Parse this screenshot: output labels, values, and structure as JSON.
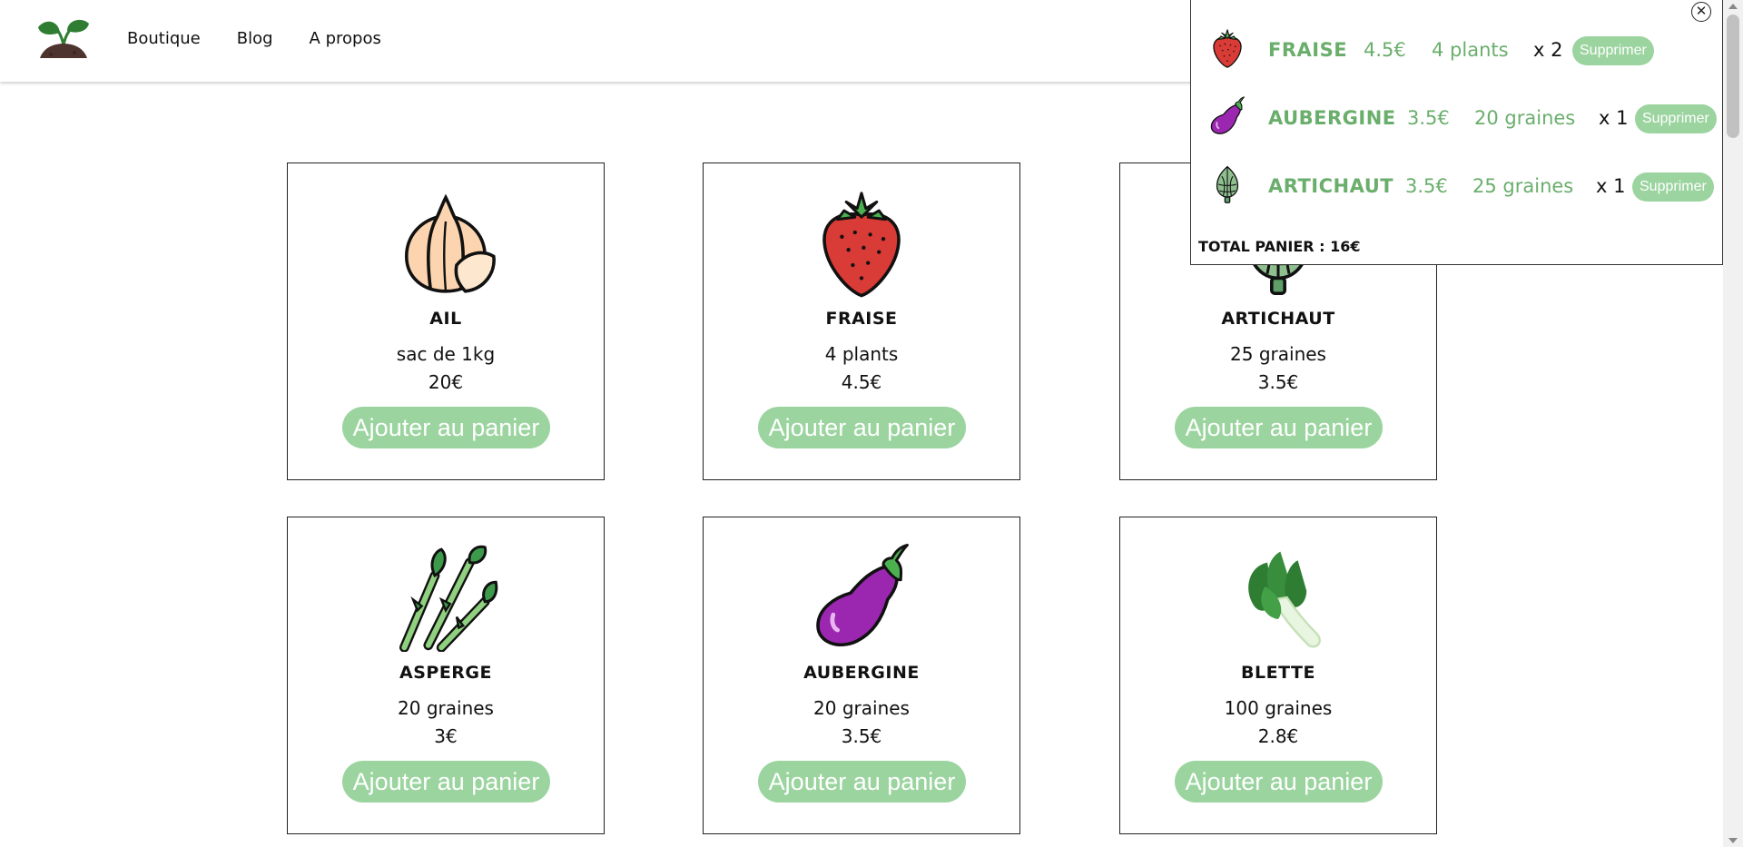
{
  "nav": {
    "items": [
      "Boutique",
      "Blog",
      "A propos"
    ]
  },
  "products": [
    {
      "name": "AIL",
      "qty": "sac de 1kg",
      "price": "20€",
      "button": "Ajouter au panier",
      "icon": "garlic-icon"
    },
    {
      "name": "FRAISE",
      "qty": "4 plants",
      "price": "4.5€",
      "button": "Ajouter au panier",
      "icon": "strawberry-icon"
    },
    {
      "name": "ARTICHAUT",
      "qty": "25 graines",
      "price": "3.5€",
      "button": "Ajouter au panier",
      "icon": "artichoke-icon"
    },
    {
      "name": "ASPERGE",
      "qty": "20 graines",
      "price": "3€",
      "button": "Ajouter au panier",
      "icon": "asparagus-icon"
    },
    {
      "name": "AUBERGINE",
      "qty": "20 graines",
      "price": "3.5€",
      "button": "Ajouter au panier",
      "icon": "eggplant-icon"
    },
    {
      "name": "BLETTE",
      "qty": "100 graines",
      "price": "2.8€",
      "button": "Ajouter au panier",
      "icon": "chard-icon"
    }
  ],
  "cart": {
    "items": [
      {
        "name": "FRAISE",
        "price": "4.5€",
        "qty": "4 plants",
        "count": "x 2",
        "delete": "Supprimer",
        "icon": "strawberry-icon"
      },
      {
        "name": "AUBERGINE",
        "price": "3.5€",
        "qty": "20 graines",
        "count": "x 1",
        "delete": "Supprimer",
        "icon": "eggplant-icon"
      },
      {
        "name": "ARTICHAUT",
        "price": "3.5€",
        "qty": "25 graines",
        "count": "x 1",
        "delete": "Supprimer",
        "icon": "artichoke-icon"
      }
    ],
    "total": "TOTAL PANIER : 16€",
    "close_icon": "close-icon"
  },
  "colors": {
    "accent": "#9bd49f",
    "cart_text": "#6aae6c"
  }
}
